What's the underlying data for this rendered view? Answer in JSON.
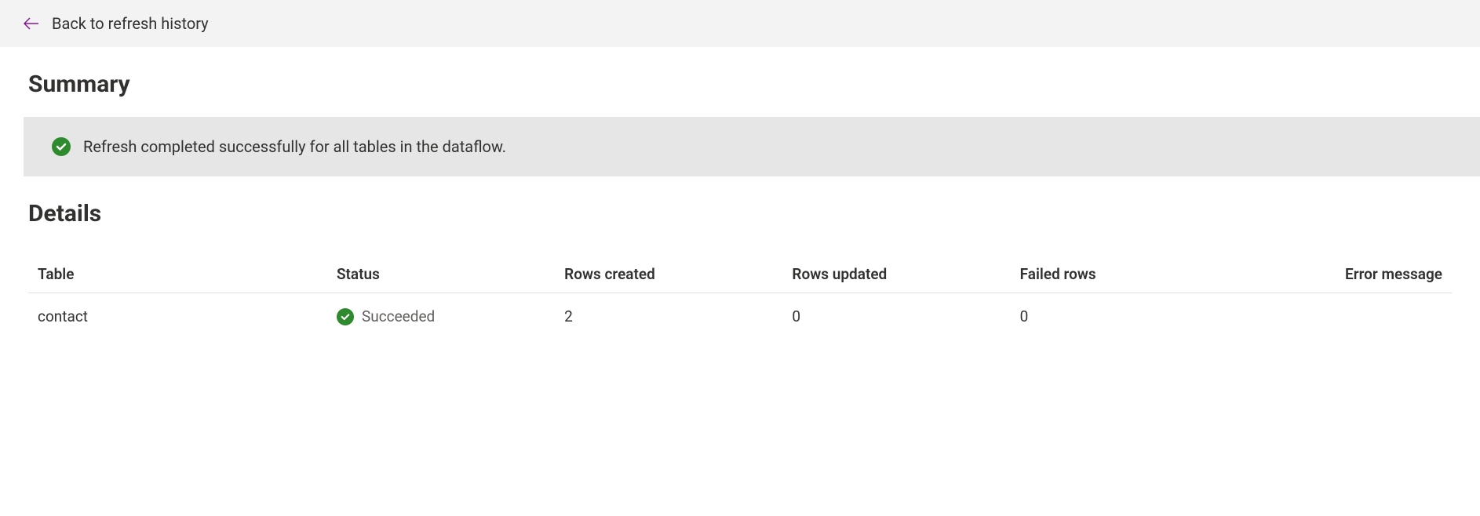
{
  "header": {
    "back_label": "Back to refresh history"
  },
  "summary": {
    "title": "Summary",
    "message": "Refresh completed successfully for all tables in the dataflow."
  },
  "details": {
    "title": "Details",
    "columns": {
      "table": "Table",
      "status": "Status",
      "rows_created": "Rows created",
      "rows_updated": "Rows updated",
      "failed_rows": "Failed rows",
      "error_message": "Error message"
    },
    "rows": [
      {
        "table": "contact",
        "status": "Succeeded",
        "rows_created": "2",
        "rows_updated": "0",
        "failed_rows": "0",
        "error_message": ""
      }
    ]
  }
}
